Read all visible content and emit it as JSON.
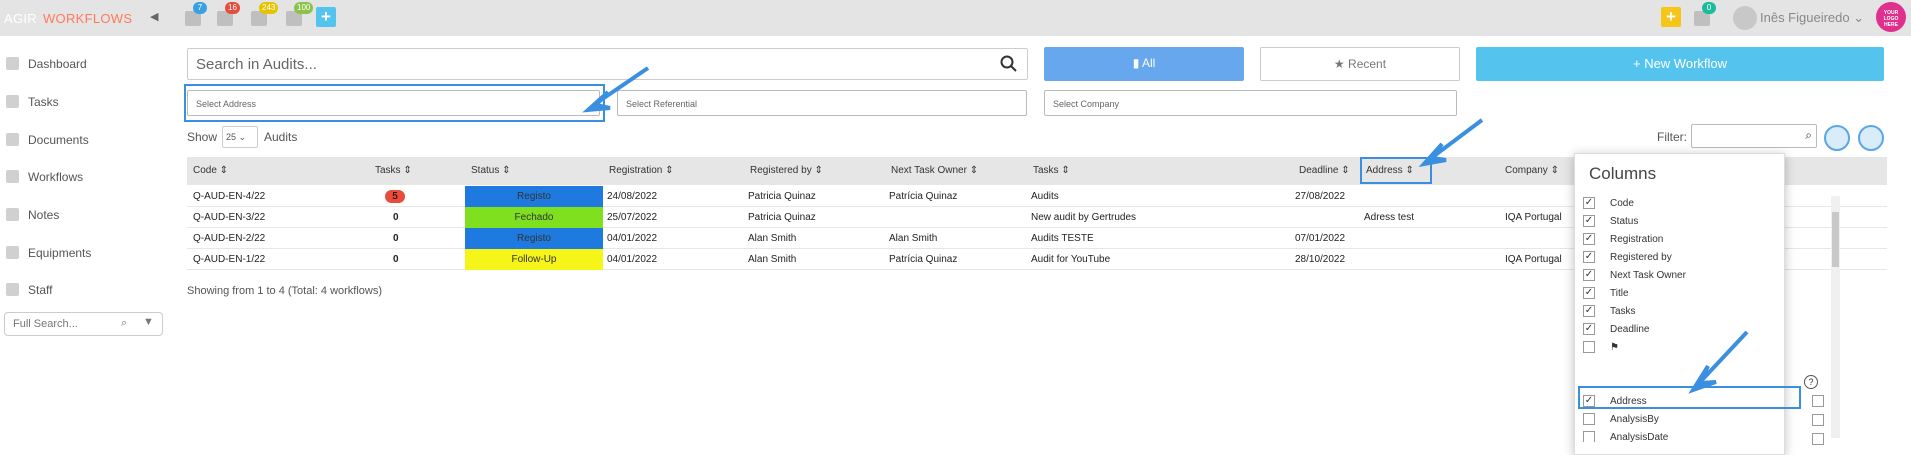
{
  "header": {
    "brand_agir": "AGIR",
    "brand_workflows": "WORKFLOWS",
    "badges": [
      "7",
      "16",
      "243",
      "100"
    ],
    "notif_badge": "0",
    "user_name": "Inês Figueiredo",
    "logo_text": "YOUR LOGO HERE"
  },
  "sidebar": {
    "items": [
      {
        "label": "Dashboard",
        "icon": "dashboard-icon"
      },
      {
        "label": "Tasks",
        "icon": "gear-icon"
      },
      {
        "label": "Documents",
        "icon": "document-icon"
      },
      {
        "label": "Workflows",
        "icon": "gears-icon"
      },
      {
        "label": "Notes",
        "icon": "chat-icon"
      },
      {
        "label": "Equipments",
        "icon": "wrench-icon"
      },
      {
        "label": "Staff",
        "icon": "person-icon"
      }
    ],
    "full_search_placeholder": "Full Search..."
  },
  "toolbar": {
    "search_placeholder": "Search in Audits...",
    "all_label": "All",
    "recent_label": "Recent",
    "new_workflow_label": "New Workflow",
    "select_address": "Select Address",
    "select_referential": "Select Referential",
    "select_company": "Select Company",
    "show_label": "Show",
    "show_value": "25",
    "audits_label": "Audits",
    "filter_label": "Filter:"
  },
  "table": {
    "columns": [
      "Code",
      "Tasks",
      "Status",
      "Registration",
      "Registered by",
      "Next Task Owner",
      "Tasks",
      "Deadline",
      "Address",
      "Company"
    ],
    "rows": [
      {
        "code": "Q-AUD-EN-4/22",
        "tasks": "5",
        "status": "Registo",
        "status_color": "#1f7ae0",
        "registration": "24/08/2022",
        "registered_by": "Patricia Quinaz",
        "next_owner": "Patrícia Quinaz",
        "title": "Audits",
        "deadline": "27/08/2022",
        "address": "",
        "company": ""
      },
      {
        "code": "Q-AUD-EN-3/22",
        "tasks": "0",
        "status": "Fechado",
        "status_color": "#7fe01f",
        "registration": "25/07/2022",
        "registered_by": "Patricia Quinaz",
        "next_owner": "",
        "title": "New audit by Gertrudes",
        "deadline": "",
        "address": "Adress test",
        "company": "IQA Portugal"
      },
      {
        "code": "Q-AUD-EN-2/22",
        "tasks": "0",
        "status": "Registo",
        "status_color": "#1f7ae0",
        "registration": "04/01/2022",
        "registered_by": "Alan Smith",
        "next_owner": "Alan Smith",
        "title": "Audits TESTE",
        "deadline": "07/01/2022",
        "address": "",
        "company": ""
      },
      {
        "code": "Q-AUD-EN-1/22",
        "tasks": "0",
        "status": "Follow-Up",
        "status_color": "#f5f51a",
        "registration": "04/01/2022",
        "registered_by": "Alan Smith",
        "next_owner": "Patrícia Quinaz",
        "title": "Audit for YouTube",
        "deadline": "28/10/2022",
        "address": "",
        "company": "IQA Portugal"
      }
    ],
    "showing_text": "Showing from 1 to 4 (Total: 4 workflows)"
  },
  "columns_panel": {
    "title": "Columns",
    "items": [
      {
        "label": "Code",
        "checked": true
      },
      {
        "label": "Status",
        "checked": true
      },
      {
        "label": "Registration",
        "checked": true
      },
      {
        "label": "Registered by",
        "checked": true
      },
      {
        "label": "Next Task Owner",
        "checked": true
      },
      {
        "label": "Title",
        "checked": true
      },
      {
        "label": "Tasks",
        "checked": true
      },
      {
        "label": "Deadline",
        "checked": true
      },
      {
        "label": "",
        "checked": false
      },
      {
        "label": "Address",
        "checked": true
      },
      {
        "label": "AnalysisBy",
        "checked": false
      },
      {
        "label": "AnalysisDate",
        "checked": false
      }
    ]
  },
  "colors": {
    "accent_blue": "#54c4ef",
    "all_button": "#67a7ee",
    "highlight": "#3a8fe0",
    "brand_orange": "#ff7a5c"
  }
}
